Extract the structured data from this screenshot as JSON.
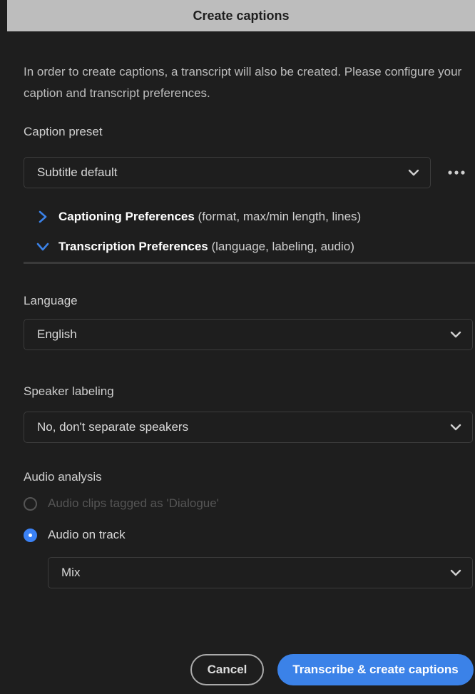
{
  "dialog": {
    "title": "Create captions"
  },
  "intro": "In order to create captions, a transcript will also be created. Please configure your caption and transcript preferences.",
  "caption_preset": {
    "label": "Caption preset",
    "value": "Subtitle default"
  },
  "sections": {
    "captioning": {
      "title": "Captioning Preferences",
      "hint": " (format, max/min length, lines)",
      "expanded": false
    },
    "transcription": {
      "title": "Transcription Preferences",
      "hint": " (language, labeling, audio)",
      "expanded": true
    }
  },
  "language": {
    "label": "Language",
    "value": "English"
  },
  "speaker_labeling": {
    "label": "Speaker labeling",
    "value": "No, don't separate speakers"
  },
  "audio_analysis": {
    "label": "Audio analysis",
    "options": [
      {
        "label": "Audio clips tagged as 'Dialogue'",
        "selected": false,
        "disabled": true
      },
      {
        "label": "Audio on track",
        "selected": true,
        "disabled": false
      }
    ],
    "track_value": "Mix"
  },
  "buttons": {
    "cancel": "Cancel",
    "primary": "Transcribe & create captions"
  },
  "colors": {
    "accent": "#3b82e8",
    "background": "#1e1e1e",
    "titlebar": "#bdbdbd"
  }
}
